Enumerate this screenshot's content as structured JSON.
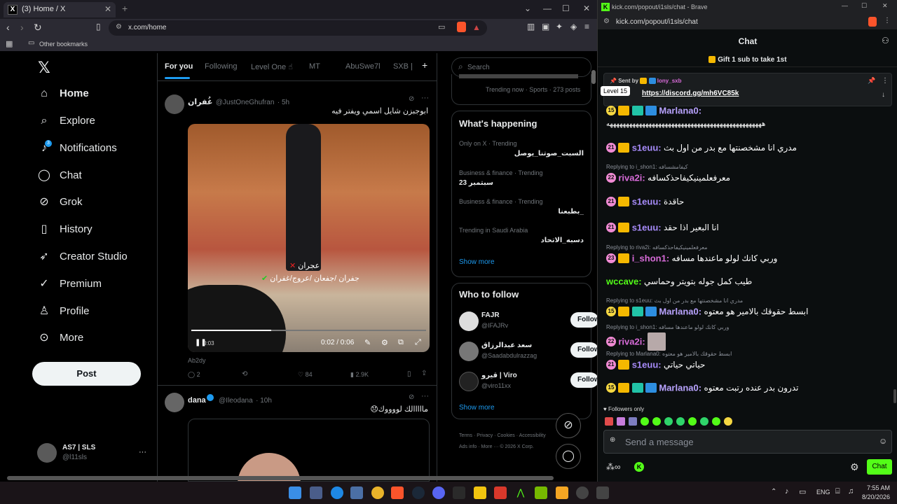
{
  "browser_left": {
    "tab_title": "(3) Home / X",
    "url": "x.com/home",
    "bookmarks_label": "Other bookmarks"
  },
  "x_nav": {
    "items": [
      {
        "label": "Home",
        "icon": "home-icon"
      },
      {
        "label": "Explore",
        "icon": "search-icon"
      },
      {
        "label": "Notifications",
        "icon": "bell-icon",
        "badge": "3"
      },
      {
        "label": "Chat",
        "icon": "chat-icon"
      },
      {
        "label": "Grok",
        "icon": "grok-icon"
      },
      {
        "label": "History",
        "icon": "bookmark-icon"
      },
      {
        "label": "Creator Studio",
        "icon": "rocket-icon"
      },
      {
        "label": "Premium",
        "icon": "verified-icon"
      },
      {
        "label": "Profile",
        "icon": "person-icon"
      },
      {
        "label": "More",
        "icon": "more-circle-icon"
      }
    ],
    "post_label": "Post",
    "account_name": "AS7 | SLS",
    "account_handle": "@l11sls"
  },
  "feed": {
    "tabs": [
      "For you",
      "Following",
      "Level One ☝",
      "MT",
      "AbuSwe7l",
      "SXB |"
    ],
    "tweet1": {
      "name": "غُفران",
      "handle": "@JustOneGhufran",
      "time": "· 5h",
      "text": "ابوجبزن شايل اسمي ويفتر فيه",
      "video_overlay1": "عجران",
      "video_overlay2": "جفران /جفعان /عروج/غفران",
      "video_time": "0:02 / 0:06",
      "video_left": "0:03",
      "source": "Ab2dy",
      "replies": "2",
      "likes": "84",
      "views": "2.9K"
    },
    "tweet2": {
      "name": "dana",
      "handle": "@Ileodana",
      "time": "· 10h",
      "text": "مااااالك لووووك😞"
    }
  },
  "sidebar_right": {
    "search_placeholder": "Search",
    "top_trend_partial": "Trending now · Sports · 273 posts",
    "whats_happening": "What's happening",
    "trends": [
      {
        "meta": "Only on X · Trending",
        "title": "السبت_صوتنا_يوصل"
      },
      {
        "meta": "Business & finance · Trending",
        "title": "23 سبتمبر"
      },
      {
        "meta": "Business & finance · Trending",
        "title": "_بطبعنا"
      },
      {
        "meta": "Trending in Saudi Arabia",
        "title": "دسبه_الاتحاد"
      }
    ],
    "show_more": "Show more",
    "who_to_follow": "Who to follow",
    "follow_suggestions": [
      {
        "name": "FAJR",
        "handle": "@IFAJRv",
        "btn": "Follow"
      },
      {
        "name": "سعد عبدالرزاق",
        "handle": "@Saadabdulrazzag",
        "btn": "Follow"
      },
      {
        "name": "قيرو | Viro",
        "handle": "@viro11xx",
        "btn": "Follow"
      }
    ],
    "show_more2": "Show more",
    "footer": [
      "Terms",
      "Privacy",
      "Cookies",
      "Accessibility",
      "Ads info",
      "More ···",
      "© 2026 X Corp."
    ]
  },
  "kick": {
    "window_title": "kick.com/popout/i1sls/chat - Brave",
    "url": "kick.com/popout/i1sls/chat",
    "header": "Chat",
    "gift_banner": "Gift 1 sub to take 1st",
    "pinned_sender_label": "Sent by",
    "pinned_sender": "lony_sxb",
    "pinned_link": "https://discord.gg/mh6VC85k",
    "tooltip": "Level 15",
    "messages": [
      {
        "level": "15",
        "user": "Marlana0",
        "color": "#b9a3ff",
        "text": "ههههههههههههههههههههههههههههههههههههههههههههههههه",
        "badges": [
          "crown",
          "pad",
          "sword"
        ],
        "reply": ""
      },
      {
        "level": "21",
        "user": "s1euu",
        "color": "#a78bfa",
        "text": "مدري انا مشخصنتها مع بدر من اول بث",
        "badges": [
          "crown"
        ],
        "reply": ""
      },
      {
        "level": "22",
        "user": "riva2i",
        "color": "#d76bd8",
        "text": "معرفعلمينيكيفاحذكسافه",
        "badges": [],
        "reply": "Replying to i_shon1: كيفامشسافه"
      },
      {
        "level": "21",
        "user": "s1euu",
        "color": "#a78bfa",
        "text": "حاقدة",
        "badges": [
          "crown"
        ],
        "reply": ""
      },
      {
        "level": "21",
        "user": "s1euu",
        "color": "#a78bfa",
        "text": "انا البعير اذا حقد",
        "badges": [
          "crown"
        ],
        "reply": ""
      },
      {
        "level": "23",
        "user": "i_shon1",
        "color": "#d76bd8",
        "text": "وربي كانك لولو ماعندها مسافه",
        "badges": [
          "crown"
        ],
        "reply": "Replying to riva2i: معرفعلمينيكيفاحذكسافه"
      },
      {
        "level": "",
        "user": "wccave",
        "color": "#53fc18",
        "text": "طيب كمل جوله بتويتر وحماسي",
        "badges": [],
        "reply": ""
      },
      {
        "level": "15",
        "user": "Marlana0",
        "color": "#b9a3ff",
        "text": "ابسط حقوقك بالامير هو معتوه",
        "badges": [
          "crown",
          "pad",
          "sword"
        ],
        "reply": "Replying to s1euu: مدري انا مشخصنتها مع بدر من اول بث"
      },
      {
        "level": "22",
        "user": "riva2i",
        "color": "#d76bd8",
        "text": "",
        "badges": [],
        "reply": "Replying to i_shon1: وربي كانك لولو ماعندها مسافه"
      },
      {
        "level": "21",
        "user": "s1euu",
        "color": "#a78bfa",
        "text": "حياتي حياتي",
        "badges": [
          "crown"
        ],
        "reply": ""
      },
      {
        "level": "15",
        "user": "Marlana0",
        "color": "#b9a3ff",
        "text": "تدرون بدر عنده رتبت معتوه",
        "badges": [
          "crown",
          "pad",
          "sword"
        ],
        "reply": "Replying to Marlana0: ابسط حقوقك بالامير هو معتوه"
      }
    ],
    "followers_only": "Followers only",
    "send_placeholder": "Send a message",
    "chat_button": "Chat"
  },
  "taskbar": {
    "lang": "ENG",
    "time": "7:55 AM",
    "date": "8/20/2026"
  },
  "colors": {
    "x_blue": "#1d9bf0",
    "kick_green": "#53fc18"
  }
}
